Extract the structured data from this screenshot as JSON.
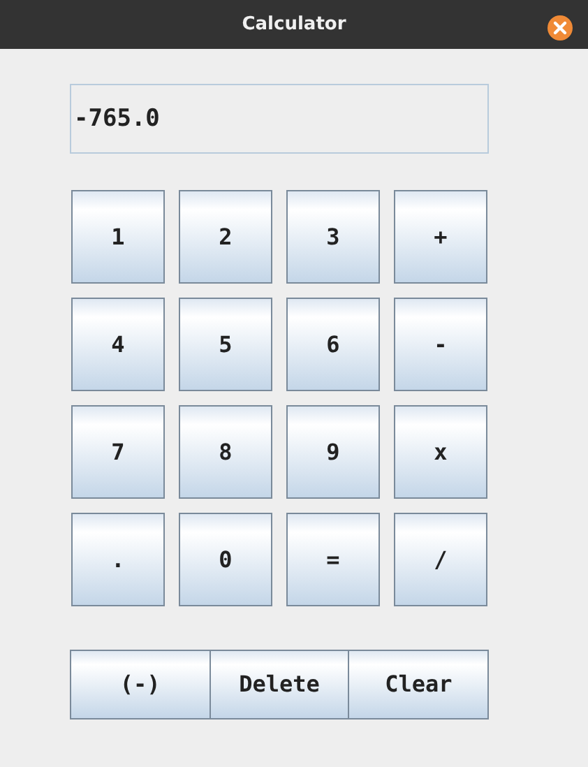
{
  "window": {
    "title": "Calculator"
  },
  "display": {
    "value": "-765.0"
  },
  "keys": [
    "1",
    "2",
    "3",
    "+",
    "4",
    "5",
    "6",
    "-",
    "7",
    "8",
    "9",
    "x",
    ".",
    "0",
    "=",
    "/"
  ],
  "bottom_buttons": [
    "(-)",
    "Delete",
    "Clear"
  ]
}
